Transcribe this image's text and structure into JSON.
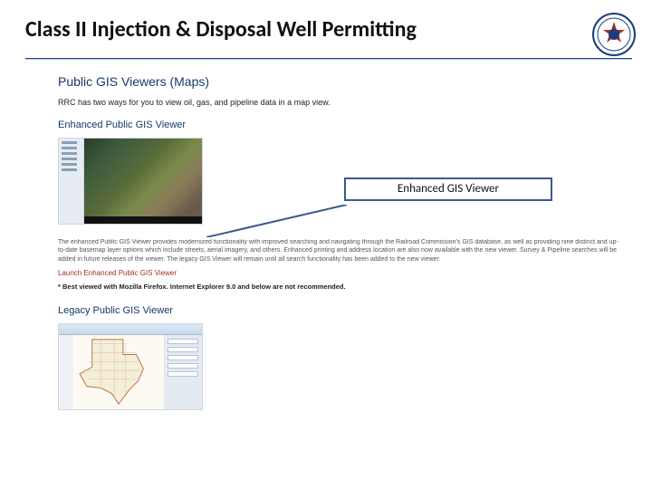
{
  "slide": {
    "title": "Class II Injection & Disposal Well Permitting"
  },
  "seal": {
    "alt": "Railroad Commission of Texas seal"
  },
  "page": {
    "heading_main": "Public GIS Viewers (Maps)",
    "intro": "RRC has two ways for you to view oil, gas, and pipeline data in a map view.",
    "heading_enhanced": "Enhanced Public GIS Viewer",
    "enhanced_desc": "The enhanced Public GIS Viewer provides modernized functionality with improved searching and navigating through the Railroad Commission's GIS database, as well as providing nine distinct and up-to-date basemap layer options which include streets, aerial imagery, and others. Enhanced printing and address location are also now available with the new viewer. Survey & Pipeline searches will be added in future releases of the viewer. The legacy GIS Viewer will remain until all search functionality has been added to the new viewer.",
    "launch_link": "Launch Enhanced Public GIS Viewer",
    "browser_note": "* Best viewed with Mozilla Firefox. Internet Explorer 9.0 and below are not recommended.",
    "heading_legacy": "Legacy Public GIS Viewer"
  },
  "callout": {
    "label": "Enhanced GIS Viewer"
  }
}
